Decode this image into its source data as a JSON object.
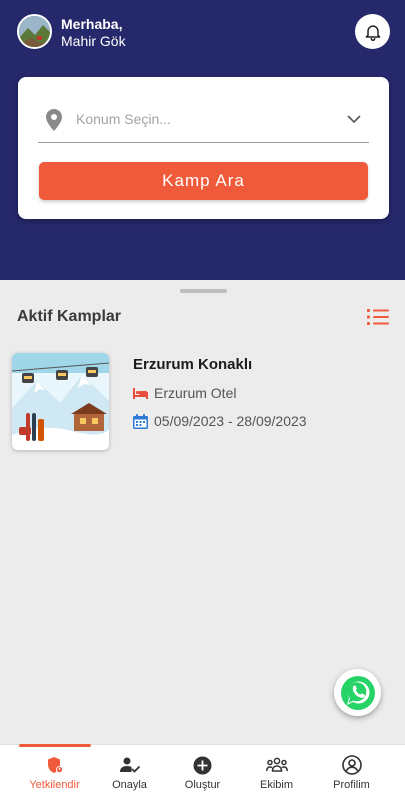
{
  "header": {
    "greeting": "Merhaba,",
    "user_name": "Mahir Gök",
    "bell_icon": "bell-icon",
    "bg_color": "#25286a"
  },
  "search": {
    "placeholder": "Konum Seçin...",
    "button_label": "Kamp Ara",
    "accent_color": "#ef5a3b"
  },
  "active_camps": {
    "title": "Aktif Kamplar",
    "items": [
      {
        "name": "Erzurum Konaklı",
        "hotel": "Erzurum Otel",
        "date_range": "05/09/2023 - 28/09/2023"
      }
    ]
  },
  "tabs": [
    {
      "label": "Yetkilendir",
      "icon": "shield-icon",
      "active": true
    },
    {
      "label": "Onayla",
      "icon": "user-check-icon",
      "active": false
    },
    {
      "label": "Oluştur",
      "icon": "plus-circle-icon",
      "active": false
    },
    {
      "label": "Ekibim",
      "icon": "team-icon",
      "active": false
    },
    {
      "label": "Profilim",
      "icon": "profile-icon",
      "active": false
    }
  ]
}
